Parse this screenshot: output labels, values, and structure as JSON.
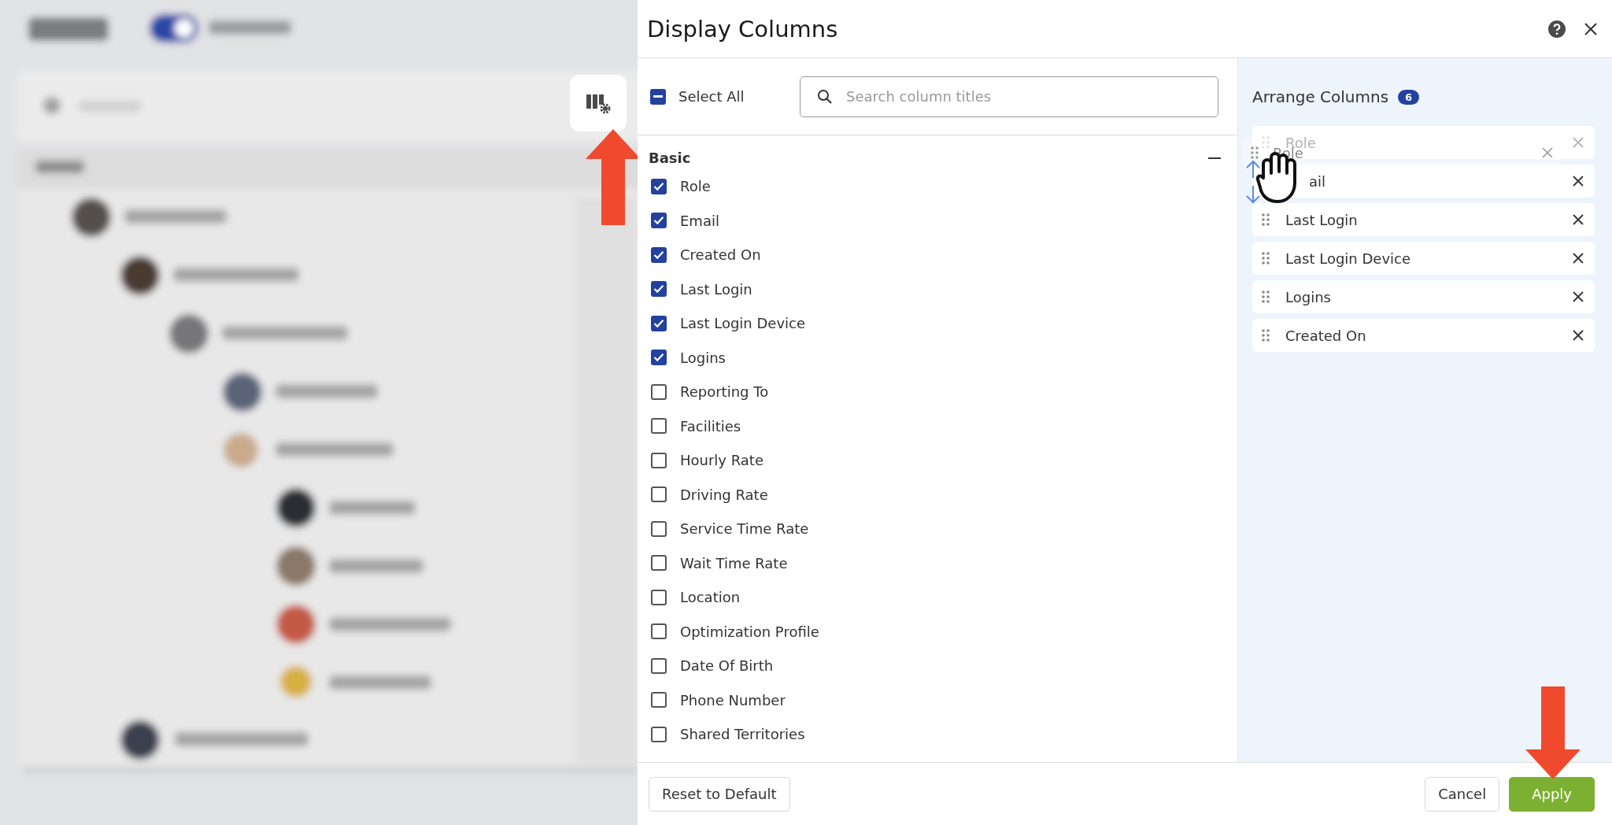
{
  "dialog": {
    "title": "Display Columns"
  },
  "select_all": {
    "label": "Select All",
    "indeterminate": true
  },
  "search": {
    "placeholder": "Search column titles"
  },
  "section": {
    "title": "Basic",
    "expanded": true,
    "items": [
      {
        "label": "Role",
        "checked": true
      },
      {
        "label": "Email",
        "checked": true
      },
      {
        "label": "Created On",
        "checked": true
      },
      {
        "label": "Last Login",
        "checked": true
      },
      {
        "label": "Last Login Device",
        "checked": true
      },
      {
        "label": "Logins",
        "checked": true
      },
      {
        "label": "Reporting To",
        "checked": false
      },
      {
        "label": "Facilities",
        "checked": false
      },
      {
        "label": "Hourly Rate",
        "checked": false
      },
      {
        "label": "Driving Rate",
        "checked": false
      },
      {
        "label": "Service Time Rate",
        "checked": false
      },
      {
        "label": "Wait Time Rate",
        "checked": false
      },
      {
        "label": "Location",
        "checked": false
      },
      {
        "label": "Optimization Profile",
        "checked": false
      },
      {
        "label": "Date Of Birth",
        "checked": false
      },
      {
        "label": "Phone Number",
        "checked": false
      },
      {
        "label": "Shared Territories",
        "checked": false
      }
    ]
  },
  "arrange": {
    "title": "Arrange Columns",
    "count": "6",
    "items": [
      {
        "label": "Role",
        "dragging": true
      },
      {
        "label": "ail",
        "dragging": false,
        "under_cursor": true
      },
      {
        "label": "Last Login",
        "dragging": false
      },
      {
        "label": "Last Login Device",
        "dragging": false
      },
      {
        "label": "Logins",
        "dragging": false
      },
      {
        "label": "Created On",
        "dragging": false
      }
    ],
    "drag_preview": {
      "label": "Role"
    }
  },
  "footer": {
    "reset": "Reset to Default",
    "cancel": "Cancel",
    "apply": "Apply"
  }
}
